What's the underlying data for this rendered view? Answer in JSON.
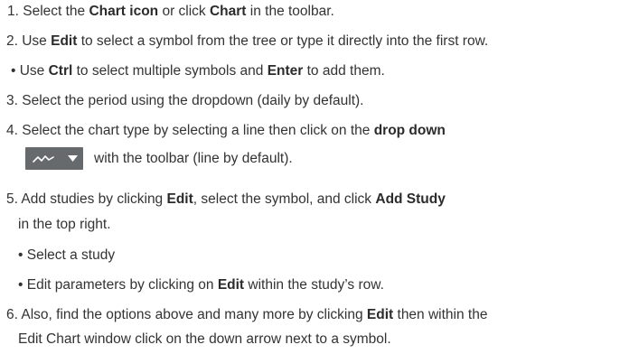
{
  "steps": {
    "s1": {
      "pre": "1. Select the ",
      "b1": "Chart icon",
      "mid": " or click  ",
      "b2": "Chart",
      "post": " in the toolbar."
    },
    "s2": {
      "pre": "2. Use ",
      "b1": "Edit",
      "post": " to select a symbol from the tree or type it directly into the first row."
    },
    "s2a": {
      "pre": "• Use ",
      "b1": "Ctrl",
      "mid": " to select multiple symbols and ",
      "b2": "Enter",
      "post": " to add them."
    },
    "s3": {
      "text": "3. Select the period using the dropdown (daily by default)."
    },
    "s4": {
      "pre": "4. Select the chart type by selecting a line then click on the ",
      "b1": "drop down"
    },
    "s4b": {
      "post": "with the toolbar (line by default)."
    },
    "s5": {
      "pre": "5. Add studies by clicking ",
      "b1": "Edit",
      "mid": ", select the symbol, and click ",
      "b2": "Add Study"
    },
    "s5b": {
      "text": "in the top right."
    },
    "s5c": {
      "text": "• Select a study"
    },
    "s5d": {
      "pre": "• Edit parameters by clicking on ",
      "b1": "Edit",
      "post": " within the study’s row."
    },
    "s6": {
      "pre": "6. Also, find the options above and many more by clicking ",
      "b1": "Edit",
      "post": " then within the"
    },
    "s6b": {
      "text": "Edit Chart window click on the down arrow next to a symbol."
    }
  },
  "icons": {
    "chart_type": "line-chart-icon",
    "dropdown": "triangle-down-icon"
  },
  "colors": {
    "text": "#333333",
    "widget_bg": "#666a6d",
    "widget_fg": "#ffffff"
  }
}
